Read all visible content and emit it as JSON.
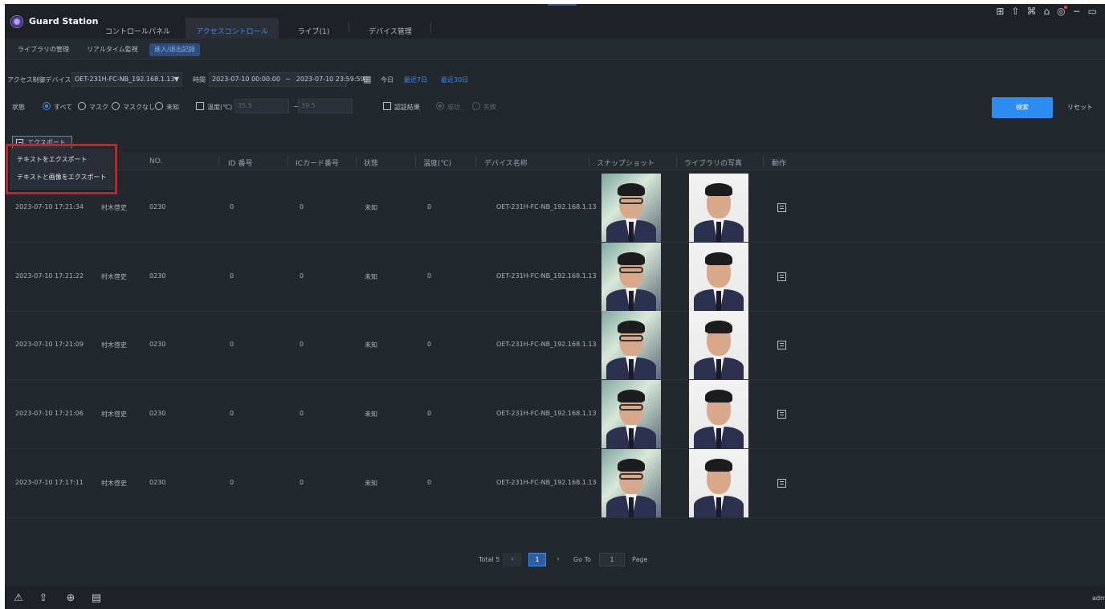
{
  "app": {
    "title": "Guard Station",
    "nav_tabs": [
      "コントロールパネル",
      "アクセスコントロール",
      "ライブ(1)",
      "デバイス管理"
    ],
    "active_nav": "アクセスコントロール",
    "sub_tabs": [
      "ライブラリの管理",
      "リアルタイム監視",
      "進入/退出記録"
    ],
    "active_sub": "進入/退出記録",
    "window_icons": [
      "grid-menu-icon",
      "shirt-icon",
      "devices-icon",
      "lock-icon",
      "help-icon",
      "minimize-icon",
      "restore-icon"
    ],
    "user": "admi"
  },
  "filters": {
    "device_label": "アクセス制御デバイス",
    "device_value": "OET-231H-FC-NB_192.168.1.13",
    "time_label": "時間",
    "time_start": "2023-07-10 00:00:00",
    "time_sep": "~",
    "time_end": "2023-07-10 23:59:59",
    "today": "今日",
    "last7": "最近7日",
    "last30": "最近30日",
    "status_label": "状態",
    "status_options": [
      "すべて",
      "マスク",
      "マスクなし",
      "未知"
    ],
    "temp_label": "温度(℃)",
    "temp_min": "35.5",
    "temp_sep": "~",
    "temp_max": "39.5",
    "auth_label": "認証結果",
    "auth_options": [
      "成功",
      "失敗"
    ],
    "search": "検索",
    "reset": "リセット"
  },
  "export": {
    "button": "エクスポート",
    "menu": [
      "テキストをエクスポート",
      "テキストと画像をエクスポート"
    ]
  },
  "table": {
    "headers": [
      "NO.",
      "ID 番号",
      "ICカード番号",
      "状態",
      "温度(℃)",
      "デバイス名称",
      "スナップショット",
      "ライブラリの写真",
      "動作"
    ],
    "rows": [
      {
        "time": "2023-07-10 17:21:34",
        "name": "村木啓史",
        "no": "0230",
        "id": "0",
        "card": "0",
        "status": "未知",
        "temp": "0",
        "device": "OET-231H-FC-NB_192.168.1.13"
      },
      {
        "time": "2023-07-10 17:21:22",
        "name": "村木啓史",
        "no": "0230",
        "id": "0",
        "card": "0",
        "status": "未知",
        "temp": "0",
        "device": "OET-231H-FC-NB_192.168.1.13"
      },
      {
        "time": "2023-07-10 17:21:09",
        "name": "村木啓史",
        "no": "0230",
        "id": "0",
        "card": "0",
        "status": "未知",
        "temp": "0",
        "device": "OET-231H-FC-NB_192.168.1.13"
      },
      {
        "time": "2023-07-10 17:21:06",
        "name": "村木啓史",
        "no": "0230",
        "id": "0",
        "card": "0",
        "status": "未知",
        "temp": "0",
        "device": "OET-231H-FC-NB_192.168.1.13"
      },
      {
        "time": "2023-07-10 17:17:11",
        "name": "村木啓史",
        "no": "0230",
        "id": "0",
        "card": "0",
        "status": "未知",
        "temp": "0",
        "device": "OET-231H-FC-NB_192.168.1.13"
      }
    ]
  },
  "pager": {
    "total": "Total 5",
    "current": "1",
    "goto": "Go To",
    "goto_value": "1",
    "page": "Page"
  }
}
